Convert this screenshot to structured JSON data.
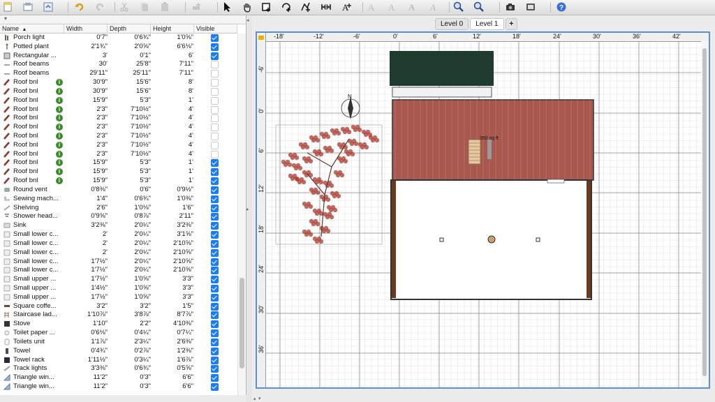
{
  "toolbar": {
    "buttons": [
      {
        "name": "new-home-button",
        "icon": "new-document-icon"
      },
      {
        "name": "open-button",
        "icon": "open-folder-icon"
      },
      {
        "name": "save-button",
        "icon": "save-icon"
      },
      {
        "name": "undo-button",
        "icon": "undo-icon"
      },
      {
        "name": "redo-button",
        "icon": "redo-icon"
      },
      {
        "name": "cut-button",
        "icon": "scissors-icon"
      },
      {
        "name": "copy-button",
        "icon": "copy-icon"
      },
      {
        "name": "paste-button",
        "icon": "paste-icon"
      },
      {
        "name": "add-furniture-button",
        "icon": "add-furniture-icon"
      },
      {
        "name": "select-mode-button",
        "icon": "arrow-pointer-icon"
      },
      {
        "name": "pan-mode-button",
        "icon": "hand-icon"
      },
      {
        "name": "create-walls-button",
        "icon": "create-walls-icon"
      },
      {
        "name": "create-rooms-button",
        "icon": "create-rooms-icon"
      },
      {
        "name": "create-polylines-button",
        "icon": "create-polylines-icon"
      },
      {
        "name": "create-dimensions-button",
        "icon": "dimension-icon"
      },
      {
        "name": "add-text-button",
        "icon": "text-icon"
      },
      {
        "name": "text-style-1-button",
        "icon": "text-style-icon"
      },
      {
        "name": "text-style-2-button",
        "icon": "text-style-icon"
      },
      {
        "name": "bold-button",
        "icon": "bold-icon"
      },
      {
        "name": "italic-button",
        "icon": "italic-icon"
      },
      {
        "name": "zoom-in-button",
        "icon": "zoom-in-icon"
      },
      {
        "name": "zoom-out-button",
        "icon": "zoom-out-icon"
      },
      {
        "name": "create-photo-button",
        "icon": "camera-icon"
      },
      {
        "name": "create-video-button",
        "icon": "video-icon"
      },
      {
        "name": "help-button",
        "icon": "help-icon"
      }
    ]
  },
  "furniture_table": {
    "sort_indicator": "▲",
    "columns": {
      "name": "Name",
      "width": "Width",
      "depth": "Depth",
      "height": "Height",
      "visible": "Visible"
    },
    "rows": [
      {
        "icon": "light-icon",
        "name": "Porch light",
        "info": false,
        "width": "0'7\"",
        "depth": "0'6¾\"",
        "height": "1'0⅝\"",
        "visible": true
      },
      {
        "icon": "plant-icon",
        "name": "Potted plant",
        "info": false,
        "width": "2'1¾\"",
        "depth": "2'0⅝\"",
        "height": "6'6⅛\"",
        "visible": true
      },
      {
        "icon": "box-icon",
        "name": "Rectangular ...",
        "info": false,
        "width": "3'",
        "depth": "0'1\"",
        "height": "6'",
        "visible": true
      },
      {
        "icon": "beam-icon",
        "name": "Roof beams",
        "info": false,
        "width": "30'",
        "depth": "25'8\"",
        "height": "7'11\"",
        "visible": false
      },
      {
        "icon": "beam-icon",
        "name": "Roof beams",
        "info": false,
        "width": "29'11\"",
        "depth": "25'11\"",
        "height": "7'11\"",
        "visible": false
      },
      {
        "icon": "roof-icon",
        "name": "Roof bnl",
        "info": true,
        "width": "30'9\"",
        "depth": "15'6\"",
        "height": "8'",
        "visible": false
      },
      {
        "icon": "roof-icon",
        "name": "Roof bnl",
        "info": true,
        "width": "30'9\"",
        "depth": "15'6\"",
        "height": "8'",
        "visible": false
      },
      {
        "icon": "roof-icon",
        "name": "Roof bnl",
        "info": true,
        "width": "15'9\"",
        "depth": "5'3\"",
        "height": "1'",
        "visible": false
      },
      {
        "icon": "roof-icon",
        "name": "Roof bnl",
        "info": true,
        "width": "2'3\"",
        "depth": "7'10½\"",
        "height": "4'",
        "visible": false
      },
      {
        "icon": "roof-icon",
        "name": "Roof bnl",
        "info": true,
        "width": "2'3\"",
        "depth": "7'10½\"",
        "height": "4'",
        "visible": false
      },
      {
        "icon": "roof-icon",
        "name": "Roof bnl",
        "info": true,
        "width": "2'3\"",
        "depth": "7'10½\"",
        "height": "4'",
        "visible": false
      },
      {
        "icon": "roof-icon",
        "name": "Roof bnl",
        "info": true,
        "width": "2'3\"",
        "depth": "7'10½\"",
        "height": "4'",
        "visible": false
      },
      {
        "icon": "roof-icon",
        "name": "Roof bnl",
        "info": true,
        "width": "2'3\"",
        "depth": "7'10½\"",
        "height": "4'",
        "visible": false
      },
      {
        "icon": "roof-icon",
        "name": "Roof bnl",
        "info": true,
        "width": "2'3\"",
        "depth": "7'10½\"",
        "height": "4'",
        "visible": false
      },
      {
        "icon": "roof-icon",
        "name": "Roof bnl",
        "info": true,
        "width": "15'9\"",
        "depth": "5'3\"",
        "height": "1'",
        "visible": true
      },
      {
        "icon": "roof-icon",
        "name": "Roof bnl",
        "info": true,
        "width": "15'9\"",
        "depth": "5'3\"",
        "height": "1'",
        "visible": true
      },
      {
        "icon": "roof-icon",
        "name": "Roof bnl",
        "info": true,
        "width": "15'9\"",
        "depth": "5'3\"",
        "height": "1'",
        "visible": true
      },
      {
        "icon": "vent-icon",
        "name": "Round vent",
        "info": false,
        "width": "0'8⅜\"",
        "depth": "0'6\"",
        "height": "0'9½\"",
        "visible": true
      },
      {
        "icon": "sewing-machine-icon",
        "name": "Sewing mach...",
        "info": false,
        "width": "1'4\"",
        "depth": "0'6¾\"",
        "height": "1'0⅜\"",
        "visible": true
      },
      {
        "icon": "shelving-icon",
        "name": "Shelving",
        "info": false,
        "width": "2'6\"",
        "depth": "1'0⅛\"",
        "height": "1'6\"",
        "visible": true
      },
      {
        "icon": "shower-icon",
        "name": "Shower head...",
        "info": false,
        "width": "0'9⅝\"",
        "depth": "0'8⅞\"",
        "height": "2'11\"",
        "visible": true
      },
      {
        "icon": "sink-icon",
        "name": "Sink",
        "info": false,
        "width": "3'2⅜\"",
        "depth": "2'0¼\"",
        "height": "3'2⅜\"",
        "visible": true
      },
      {
        "icon": "cabinet-icon",
        "name": "Small lower c...",
        "info": false,
        "width": "2'",
        "depth": "2'0¼\"",
        "height": "3'1⅝\"",
        "visible": true
      },
      {
        "icon": "cabinet-icon",
        "name": "Small lower c...",
        "info": false,
        "width": "2'",
        "depth": "2'0¼\"",
        "height": "2'10⅝\"",
        "visible": true
      },
      {
        "icon": "cabinet-icon",
        "name": "Small lower c...",
        "info": false,
        "width": "2'",
        "depth": "2'0¼\"",
        "height": "2'10⅝\"",
        "visible": true
      },
      {
        "icon": "cabinet-icon",
        "name": "Small lower c...",
        "info": false,
        "width": "1'7½\"",
        "depth": "2'0¼\"",
        "height": "2'10⅝\"",
        "visible": true
      },
      {
        "icon": "cabinet-icon",
        "name": "Small lower c...",
        "info": false,
        "width": "1'7½\"",
        "depth": "2'0¼\"",
        "height": "2'10⅝\"",
        "visible": true
      },
      {
        "icon": "cabinet-icon",
        "name": "Small upper ...",
        "info": false,
        "width": "1'7½\"",
        "depth": "1'0⅝\"",
        "height": "3'3\"",
        "visible": true
      },
      {
        "icon": "cabinet-icon",
        "name": "Small upper ...",
        "info": false,
        "width": "1'4½\"",
        "depth": "1'0⅝\"",
        "height": "3'3\"",
        "visible": true
      },
      {
        "icon": "cabinet-icon",
        "name": "Small upper ...",
        "info": false,
        "width": "1'7½\"",
        "depth": "1'0⅝\"",
        "height": "3'3\"",
        "visible": true
      },
      {
        "icon": "table-icon",
        "name": "Square coffe...",
        "info": false,
        "width": "3'2\"",
        "depth": "3'2\"",
        "height": "1'5\"",
        "visible": true
      },
      {
        "icon": "ladder-icon",
        "name": "Staircase lad...",
        "info": false,
        "width": "1'10⅞\"",
        "depth": "3'8⅞\"",
        "height": "8'7⅞\"",
        "visible": true
      },
      {
        "icon": "stove-icon",
        "name": "Stove",
        "info": false,
        "width": "1'10\"",
        "depth": "2'2\"",
        "height": "4'10⅜\"",
        "visible": true
      },
      {
        "icon": "toilet-paper-icon",
        "name": "Toilet paper ...",
        "info": false,
        "width": "0'6⅛\"",
        "depth": "0'4¼\"",
        "height": "0'7¼\"",
        "visible": true
      },
      {
        "icon": "toilet-icon",
        "name": "Toilets unit",
        "info": false,
        "width": "1'1⅞\"",
        "depth": "2'3¼\"",
        "height": "2'6⅜\"",
        "visible": true
      },
      {
        "icon": "towel-icon",
        "name": "Towel",
        "info": false,
        "width": "0'4¾\"",
        "depth": "0'2⅞\"",
        "height": "1'2⅜\"",
        "visible": true
      },
      {
        "icon": "towel-rack-icon",
        "name": "Towel rack",
        "info": false,
        "width": "1'11½\"",
        "depth": "0'3¼\"",
        "height": "1'6⅞\"",
        "visible": true
      },
      {
        "icon": "track-light-icon",
        "name": "Track lights",
        "info": false,
        "width": "3'3⅜\"",
        "depth": "0'6¾\"",
        "height": "0'5⅝\"",
        "visible": true
      },
      {
        "icon": "triangle-window-icon",
        "name": "Triangle win...",
        "info": false,
        "width": "11'2\"",
        "depth": "0'3\"",
        "height": "6'6\"",
        "visible": true
      },
      {
        "icon": "triangle-window-icon",
        "name": "Triangle win...",
        "info": false,
        "width": "11'2\"",
        "depth": "0'3\"",
        "height": "6'6\"",
        "visible": true
      }
    ]
  },
  "level_tabs": [
    {
      "label": "Level 0",
      "selected": false
    },
    {
      "label": "Level 1",
      "selected": true
    }
  ],
  "add_level_label": "+",
  "plan": {
    "h_ruler": [
      "-18'",
      "-12'",
      "-6'",
      "0'",
      "6'",
      "12'",
      "18'",
      "24'",
      "30'",
      "36'",
      "42'"
    ],
    "v_ruler": [
      "-6'",
      "0'",
      "6'",
      "12'",
      "18'",
      "24'",
      "30'",
      "36'"
    ],
    "area_label": "350 sq ft",
    "compass_label": "N",
    "colors": {
      "roof": "#a8584e",
      "dark_roof": "#1e3b2e",
      "wood": "#6b3a1c",
      "tree": "#a8392f",
      "selection": "#5d8fd6"
    }
  }
}
